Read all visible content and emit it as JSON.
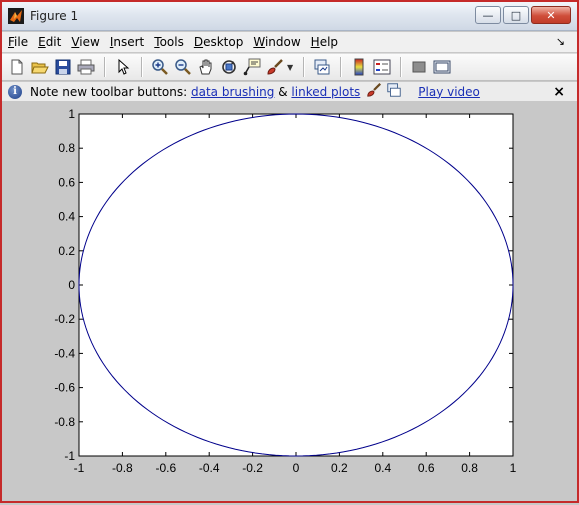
{
  "window": {
    "title": "Figure 1",
    "controls": {
      "minimize": "—",
      "maximize": "□",
      "close": "✕"
    }
  },
  "menubar": {
    "items": [
      {
        "label": "File",
        "mnemonic": "F",
        "rest": "ile"
      },
      {
        "label": "Edit",
        "mnemonic": "E",
        "rest": "dit"
      },
      {
        "label": "View",
        "mnemonic": "V",
        "rest": "iew"
      },
      {
        "label": "Insert",
        "mnemonic": "I",
        "rest": "nsert"
      },
      {
        "label": "Tools",
        "mnemonic": "T",
        "rest": "ools"
      },
      {
        "label": "Desktop",
        "mnemonic": "D",
        "rest": "esktop"
      },
      {
        "label": "Window",
        "mnemonic": "W",
        "rest": "indow"
      },
      {
        "label": "Help",
        "mnemonic": "H",
        "rest": "elp"
      }
    ],
    "dock_glyph": "↘"
  },
  "toolbar": {
    "buttons": [
      "new-figure-icon",
      "open-file-icon",
      "save-icon",
      "print-icon",
      "separator",
      "edit-plot-arrow-icon",
      "separator",
      "zoom-in-icon",
      "zoom-out-icon",
      "pan-hand-icon",
      "rotate-3d-icon",
      "data-cursor-icon",
      "brush-icon",
      "dropdown",
      "separator",
      "link-plot-icon",
      "separator",
      "colorbar-icon",
      "legend-icon",
      "separator",
      "hide-plot-tools-icon",
      "show-plot-tools-icon"
    ]
  },
  "infobar": {
    "prefix": "Note new toolbar buttons:",
    "link1": "data brushing",
    "amp": "&",
    "link2": "linked plots",
    "play": "Play video",
    "close": "×"
  },
  "colors": {
    "line": "#00008b",
    "figure_bg": "#c8c8c8",
    "axes_bg": "#ffffff",
    "link": "#1a2fb6"
  },
  "chart_data": {
    "type": "line",
    "title": "",
    "xlabel": "",
    "ylabel": "",
    "xlim": [
      -1,
      1
    ],
    "ylim": [
      -1,
      1
    ],
    "grid": false,
    "xticks": [
      -1,
      -0.8,
      -0.6,
      -0.4,
      -0.2,
      0,
      0.2,
      0.4,
      0.6,
      0.8,
      1
    ],
    "xticklabels": [
      "-1",
      "-0.8",
      "-0.6",
      "-0.4",
      "-0.2",
      "0",
      "0.2",
      "0.4",
      "0.6",
      "0.8",
      "1"
    ],
    "yticks": [
      1,
      0.8,
      0.6,
      0.4,
      0.2,
      0,
      -0.2,
      -0.4,
      -0.6,
      -0.8,
      -1
    ],
    "yticklabels": [
      "1",
      "0.8",
      "0.6",
      "0.4",
      "0.2",
      "0",
      "-0.2",
      "-0.4",
      "-0.6",
      "-0.8",
      "-1"
    ],
    "series": [
      {
        "shape": "unit circle",
        "x": [
          1,
          0.866,
          0.5,
          0,
          -0.5,
          -0.866,
          -1,
          -0.866,
          -0.5,
          0,
          0.5,
          0.866,
          1
        ],
        "y": [
          0,
          0.5,
          0.866,
          1,
          0.866,
          0.5,
          0,
          -0.5,
          -0.866,
          -1,
          -0.866,
          -0.5,
          0
        ],
        "color": "#00008b"
      }
    ]
  }
}
